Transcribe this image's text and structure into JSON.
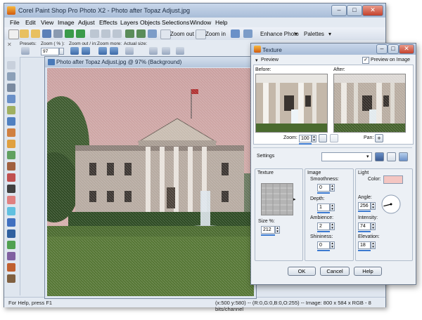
{
  "app": {
    "title": "Corel Paint Shop Pro Photo X2 - Photo after Topaz Adjust.jpg",
    "menus": [
      "File",
      "Edit",
      "View",
      "Image",
      "Adjust",
      "Effects",
      "Layers",
      "Objects",
      "Selections",
      "Window",
      "Help"
    ],
    "toolbar": {
      "zoom_out": "Zoom out",
      "zoom_in": "Zoom in",
      "enhance_photo": "Enhance Photo",
      "palettes": "Palettes"
    },
    "tool_options": {
      "presets": "Presets:",
      "zoom_pct_label": "Zoom ( % ):",
      "zoom_pct_value": "97",
      "zoom_out_in": "Zoom out / in:",
      "zoom_more": "Zoom more:",
      "actual_size": "Actual size:"
    },
    "status": {
      "help": "For Help, press F1",
      "info": "(x:500 y:580) -- (R:0,G:0,B:0,O:255) -- Image:  800 x 584 x RGB - 8 bits/channel"
    }
  },
  "document": {
    "title": "Photo after Topaz Adjust.jpg @  97% (Background)"
  },
  "dialog": {
    "title": "Texture",
    "preview_toggle": "Preview",
    "preview_on_image": "Preview on Image",
    "preview_on_image_checked": true,
    "before_label": "Before:",
    "after_label": "After:",
    "zoom_label": "Zoom:",
    "zoom_value": "100",
    "pan_label": "Pan:",
    "settings_label": "Settings",
    "settings_value": "",
    "texture_group": "Texture",
    "size_label": "Size %:",
    "size_value": "212",
    "image_group": "Image",
    "smoothness_label": "Smoothness:",
    "smoothness_value": "0",
    "depth_label": "Depth:",
    "depth_value": "1",
    "ambience_label": "Ambience:",
    "ambience_value": "2",
    "shininess_label": "Shininess:",
    "shininess_value": "0",
    "light_group": "Light",
    "color_label": "Color:",
    "light_color": "#f4c6c2",
    "angle_label": "Angle:",
    "angle_value": "256",
    "intensity_label": "Intensity:",
    "intensity_value": "74",
    "elevation_label": "Elevation:",
    "elevation_value": "18",
    "ok": "OK",
    "cancel": "Cancel",
    "help": "Help"
  }
}
